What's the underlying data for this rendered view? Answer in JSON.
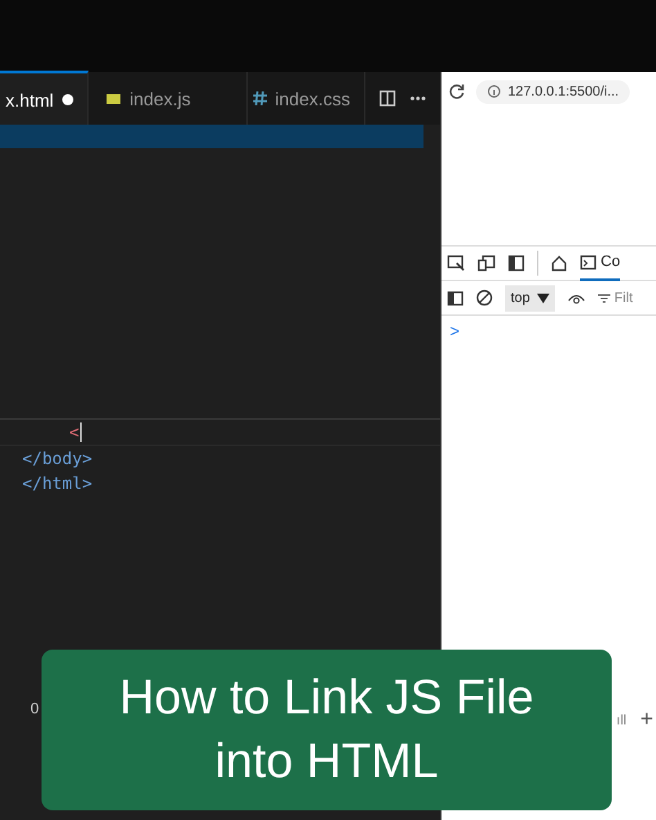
{
  "editor": {
    "tabs": [
      {
        "label": "x.html",
        "kind": "plain",
        "selected": true,
        "modified": true
      },
      {
        "label": "index.js",
        "kind": "script",
        "selected": false,
        "modified": false
      },
      {
        "label": "index.css",
        "kind": "style",
        "selected": false,
        "modified": false
      }
    ],
    "lines": [
      {
        "kind": "cursor",
        "text": "<"
      },
      {
        "kind": "tag",
        "text": "</body>"
      },
      {
        "kind": "tag",
        "text": "</html>"
      }
    ]
  },
  "browser": {
    "url": "127.0.0.1:5500/i...",
    "devtools_tab": "Co",
    "context": "top",
    "filter_placeholder": "Filt",
    "prompt": ">",
    "tab_fragment": "ıll",
    "add_tab": "+"
  },
  "status_bar": {
    "text": "0"
  },
  "banner": {
    "title": "How to Link JS File into HTML"
  }
}
